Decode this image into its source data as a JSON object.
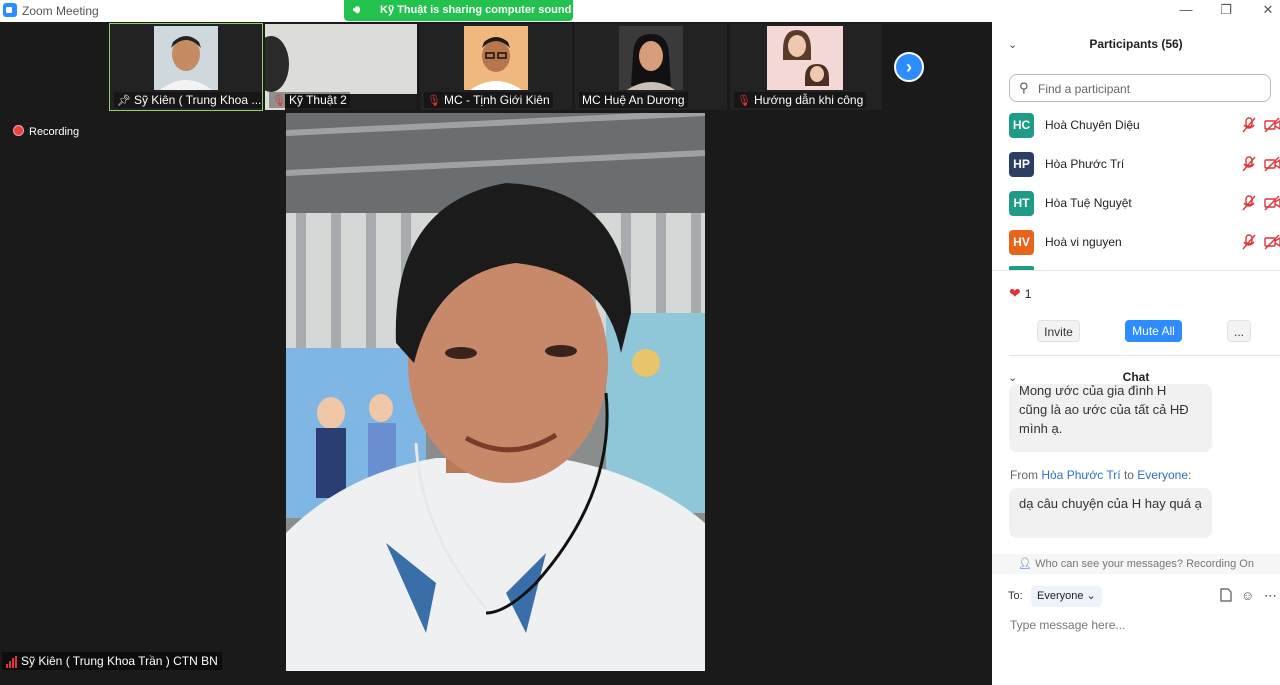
{
  "window": {
    "title": "Zoom Meeting",
    "minimize": "—",
    "restore": "❐",
    "close": "✕"
  },
  "banner": {
    "text": "Kỹ Thuật is sharing computer sound",
    "icon": "speaker-icon"
  },
  "thumbnails": [
    {
      "name": "Sỹ Kiên ( Trung Khoa ...",
      "muted": false,
      "pinned": true
    },
    {
      "name": "Kỹ Thuật 2",
      "muted": true
    },
    {
      "name": "MC - Tịnh Giới Kiên",
      "muted": true
    },
    {
      "name": "MC Huệ An Dương",
      "muted": false
    },
    {
      "name": "Hướng dẫn khi công",
      "muted": true
    }
  ],
  "next_icon": "›",
  "recording": {
    "label": "Recording"
  },
  "speaker": {
    "name": "Sỹ Kiên ( Trung Khoa Trần ) CTN BN"
  },
  "participants": {
    "header": "Participants (56)",
    "search_placeholder": "Find a participant",
    "list": [
      {
        "initials": "HC",
        "name": "Hoà Chuyên Diệu",
        "color": "#1f9b87"
      },
      {
        "initials": "HP",
        "name": "Hòa Phước Trí",
        "color": "#2c3e63"
      },
      {
        "initials": "HT",
        "name": "Hòa Tuệ Nguyệt",
        "color": "#1f9b87"
      },
      {
        "initials": "HV",
        "name": "Hoà vi nguyen",
        "color": "#e6651a"
      }
    ],
    "reaction_count": "1",
    "invite_label": "Invite",
    "mute_all_label": "Mute All",
    "more_label": "..."
  },
  "chat": {
    "header": "Chat",
    "message1_lines": [
      "Mong ước của gia đình H",
      "cũng là ao ước của tất cả HĐ",
      "mình ạ."
    ],
    "from_prefix": "From ",
    "from_sender": "Hòa Phước Trí",
    "to_word": " to ",
    "to_target": "Everyone",
    "colon": ":",
    "message2": "dạ câu chuyện của H hay quá ạ",
    "privacy_note": "Who can see your messages? Recording On",
    "to_label": "To:",
    "recipient": "Everyone",
    "input_placeholder": "Type message here..."
  },
  "colors": {
    "accent": "#2d8cff",
    "banner": "#23c14e",
    "mic_off": "#e0333a"
  }
}
